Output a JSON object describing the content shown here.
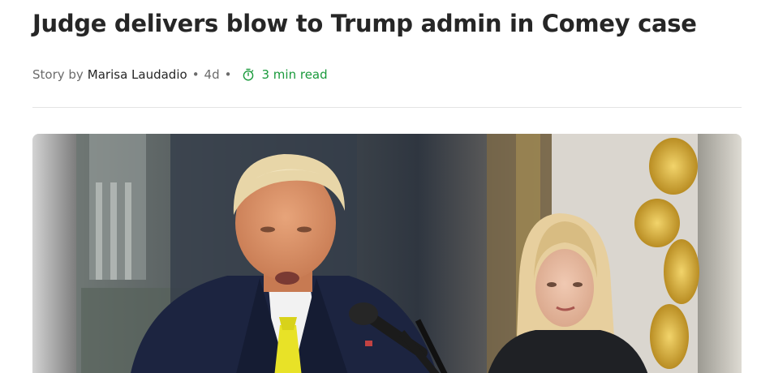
{
  "article": {
    "headline": "Judge delivers blow to Trump admin in Comey case",
    "byline": {
      "prefix": "Story by",
      "author": "Marisa Laudadio",
      "age": "4d",
      "separator": "•",
      "read_time": "3 min read",
      "read_time_icon": "stopwatch-icon",
      "read_time_color": "#1a9a3c"
    },
    "hero_image": {
      "kind": "photo"
    }
  }
}
